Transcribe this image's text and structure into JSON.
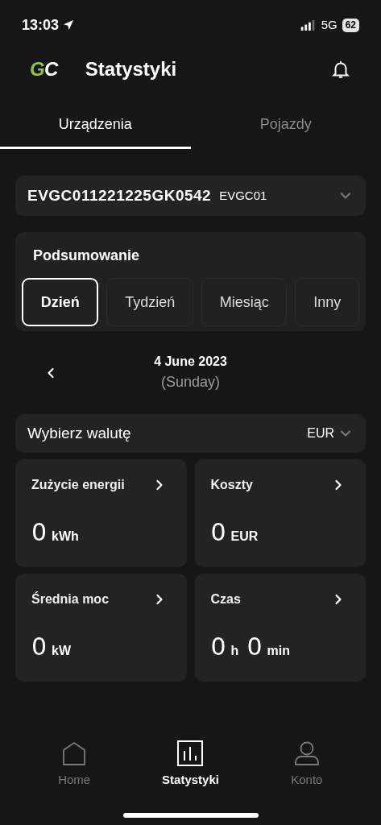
{
  "status_bar": {
    "time": "13:03",
    "network": "5G",
    "battery": "62"
  },
  "header": {
    "logo": [
      {
        "text": "G",
        "color": "#8cc63f"
      },
      {
        "text": "C",
        "color": "#ffffff"
      }
    ],
    "title": "Statystyki"
  },
  "tabs": [
    {
      "label": "Urządzenia",
      "selected": true
    },
    {
      "label": "Pojazdy",
      "selected": false
    }
  ],
  "device": {
    "serial": "EVGC011221225GK0542",
    "model": "EVGC01"
  },
  "summary": {
    "title": "Podsumowanie",
    "periods": [
      {
        "label": "Dzień",
        "selected": true
      },
      {
        "label": "Tydzień",
        "selected": false
      },
      {
        "label": "Miesiąc",
        "selected": false
      },
      {
        "label": "Inny",
        "selected": false
      }
    ]
  },
  "date": {
    "date": "4 June 2023",
    "weekday": "(Sunday)"
  },
  "currency": {
    "label": "Wybierz walutę",
    "value": "EUR"
  },
  "metrics": [
    {
      "title": "Zużycie energii",
      "parts": [
        {
          "value": "0",
          "unit": "kWh"
        }
      ]
    },
    {
      "title": "Koszty",
      "parts": [
        {
          "value": "0",
          "unit": "EUR"
        }
      ]
    },
    {
      "title": "Średnia moc",
      "parts": [
        {
          "value": "0",
          "unit": "kW"
        }
      ]
    },
    {
      "title": "Czas",
      "parts": [
        {
          "value": "0",
          "unit": "h"
        },
        {
          "value": "0",
          "unit": "min"
        }
      ]
    }
  ],
  "nav": [
    {
      "kind": "home",
      "label": "Home",
      "selected": false
    },
    {
      "kind": "stats",
      "label": "Statystyki",
      "selected": true
    },
    {
      "kind": "account",
      "label": "Konto",
      "selected": false
    }
  ]
}
